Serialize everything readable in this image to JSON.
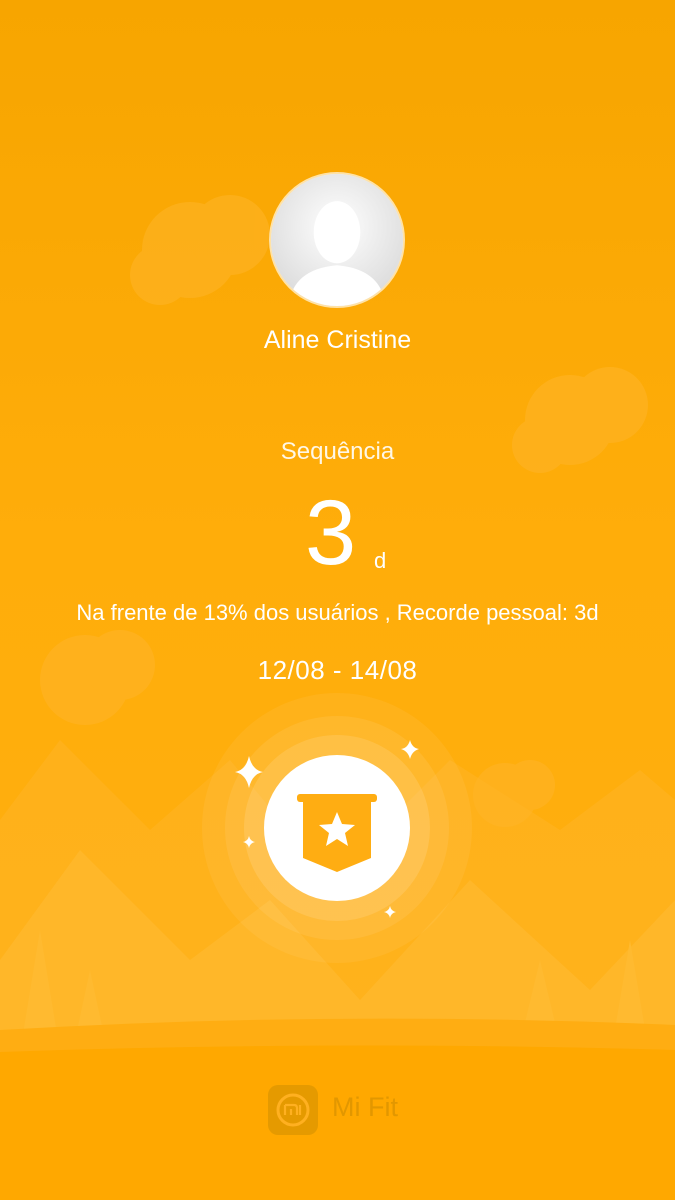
{
  "profile": {
    "avatar_icon": "default-user-silhouette",
    "name": "Aline Cristine"
  },
  "streak": {
    "label": "Sequência",
    "value": "3",
    "unit": "d",
    "stats": "Na frente de 13% dos usuários , Recorde pessoal: 3d",
    "date_range": "12/08 - 14/08"
  },
  "badge": {
    "icon": "star-banner-icon"
  },
  "footer": {
    "logo_icon": "mi-logo-icon",
    "brand": "Mi Fit"
  },
  "colors": {
    "background": "#ffad0a",
    "accent": "#ffad12",
    "text": "#ffffff"
  }
}
